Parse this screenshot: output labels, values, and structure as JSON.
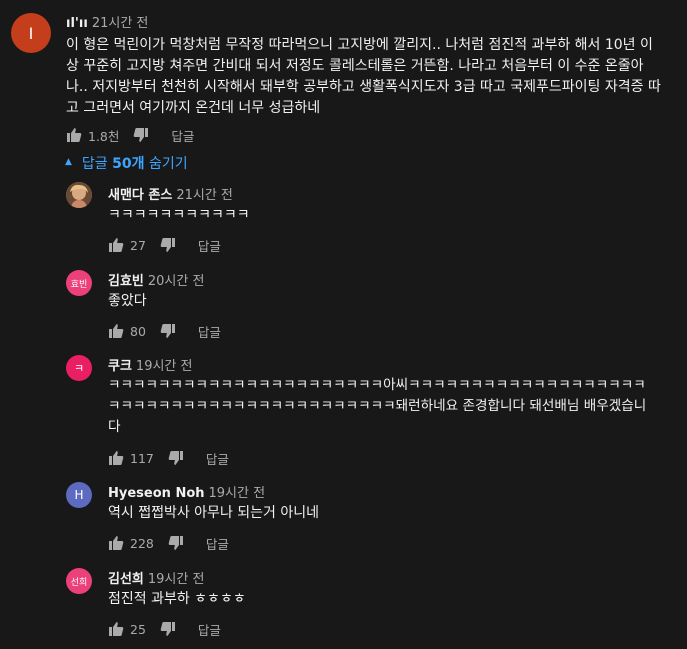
{
  "main_comment": {
    "avatar_letter": "I",
    "avatar_color": "#c43e1c",
    "author": "ıl'ıı",
    "time": "21시간 전",
    "text": "이 형은 먹린이가 먹창처럼 무작정 따라먹으니 고지방에 깔리지.. 나처럼 점진적 과부하 해서 10년 이상 꾸준히 고지방 쳐주면 간비대 되서 저정도 콜레스테롤은 거뜬함. 나라고 처음부터 이 수준 온줄아나.. 저지방부터 천천히 시작해서 돼부학 공부하고 생활폭식지도자 3급 따고 국제푸드파이팅 자격증 따고 그러면서 여기까지 온건데 너무 성급하네",
    "likes": "1.8천",
    "reply_label": "답글"
  },
  "replies_toggle": {
    "prefix": "답글",
    "count": "50개",
    "suffix": "숨기기"
  },
  "replies": [
    {
      "author": "새맨다 존스",
      "time": "21시간 전",
      "text": "ㅋㅋㅋㅋㅋㅋㅋㅋㅋㅋㅋ",
      "likes": "27",
      "reply_label": "답글",
      "avatar_text": "",
      "avatar_color": "#b58a63"
    },
    {
      "author": "김효빈",
      "time": "20시간 전",
      "text": "좋았다",
      "likes": "80",
      "reply_label": "답글",
      "avatar_text": "효빈",
      "avatar_color": "#ec407a"
    },
    {
      "author": "쿠크",
      "time": "19시간 전",
      "text": "ㅋㅋㅋㅋㅋㅋㅋㅋㅋㅋㅋㅋㅋㅋㅋㅋㅋㅋㅋㅋㅋㅋ아씨ㅋㅋㅋㅋㅋㅋㅋㅋㅋㅋㅋㅋㅋㅋㅋㅋㅋㅋㅋㅋㅋㅋㅋㅋㅋㅋㅋㅋㅋㅋㅋㅋㅋㅋㅋㅋㅋㅋㅋㅋㅋㅋ돼런하네요 존경합니다 돼선배님 배우겠습니다",
      "likes": "117",
      "reply_label": "답글",
      "avatar_text": "ㅋ",
      "avatar_color": "#e91e63"
    },
    {
      "author": "Hyeseon Noh",
      "time": "19시간 전",
      "text": "역시 쩝쩝박사 아무나 되는거 아니네",
      "likes": "228",
      "reply_label": "답글",
      "avatar_text": "H",
      "avatar_color": "#5c6bc0"
    },
    {
      "author": "김선희",
      "time": "19시간 전",
      "text": "점진적 과부하 ㅎㅎㅎㅎ",
      "likes": "25",
      "reply_label": "답글",
      "avatar_text": "선희",
      "avatar_color": "#ec407a"
    }
  ]
}
